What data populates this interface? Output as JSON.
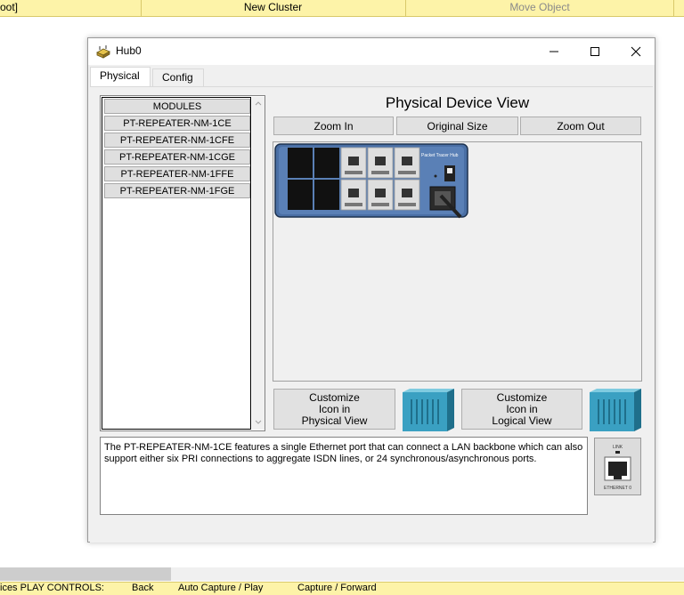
{
  "app_toolbar": {
    "left_text": "oot]",
    "center_text": "New Cluster",
    "right_text": "Move Object"
  },
  "bottom_bar": {
    "items": [
      "ices  PLAY CONTROLS:",
      "Back",
      "Auto Capture / Play",
      "Capture / Forward"
    ]
  },
  "window": {
    "title": "Hub0",
    "controls": {
      "minimize": "minimize",
      "maximize": "maximize",
      "close": "close"
    }
  },
  "tabs": [
    {
      "label": "Physical",
      "active": true
    },
    {
      "label": "Config",
      "active": false
    }
  ],
  "modules": {
    "header": "MODULES",
    "items": [
      "PT-REPEATER-NM-1CE",
      "PT-REPEATER-NM-1CFE",
      "PT-REPEATER-NM-1CGE",
      "PT-REPEATER-NM-1FFE",
      "PT-REPEATER-NM-1FGE"
    ]
  },
  "physical_view": {
    "title": "Physical Device View",
    "zoom_in": "Zoom In",
    "original_size": "Original Size",
    "zoom_out": "Zoom Out",
    "device_brand_text": "Packet Tracer Hub"
  },
  "customize": {
    "physical": [
      "Customize",
      "Icon in",
      "Physical View"
    ],
    "logical": [
      "Customize",
      "Icon in",
      "Logical View"
    ]
  },
  "description": "The PT-REPEATER-NM-1CE features a single Ethernet port that can connect a LAN backbone which can also support either six PRI connections to aggregate ISDN lines, or 24 synchronous/asynchronous ports.",
  "port_image": {
    "top_label": "LINK",
    "bottom_label": "ETHERNET 0"
  },
  "colors": {
    "toolbar_bg": "#fdf3a8",
    "hub_body": "#4a6fa5",
    "cube": "#3aa0c2"
  }
}
